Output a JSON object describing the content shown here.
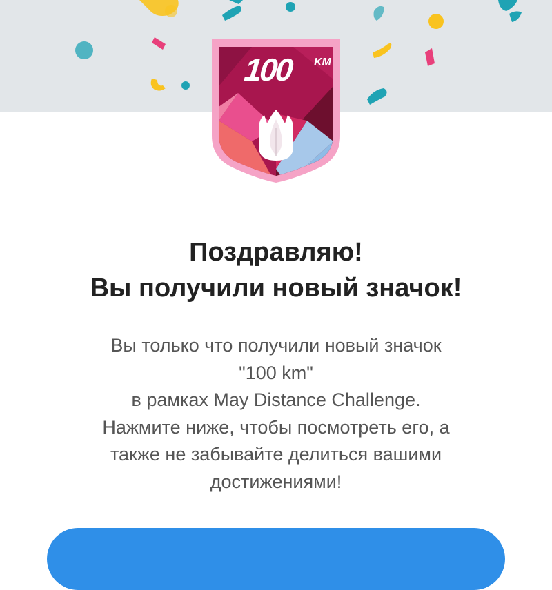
{
  "badge": {
    "value": "100",
    "unit": "KM",
    "icon": "tulip-icon",
    "colors": {
      "frame": "#f5a3c6",
      "crimson": "#a8164e",
      "dark": "#6d0f2e",
      "coral": "#ef6a6a",
      "pink": "#e94f8e",
      "blue": "#8fbbe6"
    }
  },
  "header": {
    "title_line1": "Поздравляю!",
    "title_line2": "Вы получили новый значок!"
  },
  "message": {
    "lines": [
      "Вы только что получили новый значок",
      "\"100 km\"",
      "в рамках May Distance Challenge.",
      "Нажмите ниже, чтобы посмотреть его, а",
      "также не забывайте делиться вашими",
      "достижениями!"
    ]
  },
  "action": {
    "button_color": "#2f8fe8"
  },
  "confetti_colors": {
    "yellow": "#f9c31f",
    "teal": "#1fa3b4",
    "pink": "#e8407b",
    "background": "#e2e6e9"
  }
}
